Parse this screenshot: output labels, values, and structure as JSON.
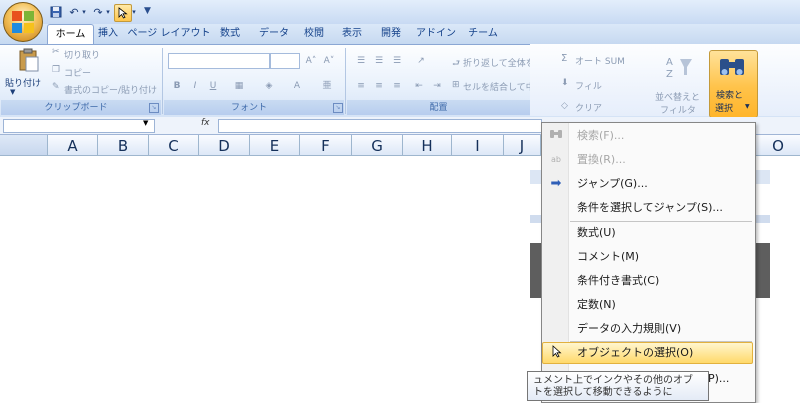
{
  "qat": {
    "customize": "▼"
  },
  "tabs": [
    {
      "label": "ホーム"
    },
    {
      "label": "挿入"
    },
    {
      "label": "ページ レイアウト"
    },
    {
      "label": "数式"
    },
    {
      "label": "データ"
    },
    {
      "label": "校閲"
    },
    {
      "label": "表示"
    },
    {
      "label": "開発"
    },
    {
      "label": "アドイン"
    },
    {
      "label": "チーム"
    }
  ],
  "clipboard": {
    "paste": "貼り付け",
    "cut": "切り取り",
    "copy": "コピー",
    "format_painter": "書式のコピー/貼り付け",
    "group": "クリップボード"
  },
  "font": {
    "group": "フォント",
    "bold": "B",
    "italic": "I",
    "underline": "U"
  },
  "alignment": {
    "wrap": "折り返して全体を",
    "merge": "セルを結合して中",
    "group": "配置"
  },
  "editing": {
    "autosum": "オート SUM",
    "fill": "フィル",
    "clear": "クリア",
    "sort_filter_1": "並べ替えと",
    "sort_filter_2": "フィルタ",
    "find_select_1": "検索と",
    "find_select_2": "選択",
    "dropdown_glyph": "▼"
  },
  "formula_bar": {
    "fx": "fx"
  },
  "columns": [
    "A",
    "B",
    "C",
    "D",
    "E",
    "F",
    "G",
    "H",
    "I",
    "J",
    "O"
  ],
  "menu": {
    "items": [
      {
        "label": "検索(F)...",
        "icon": "binoculars-icon",
        "disabled": true
      },
      {
        "label": "置換(R)...",
        "icon": "replace-icon",
        "disabled": true
      },
      {
        "label": "ジャンプ(G)...",
        "icon": "arrow-right-icon"
      },
      {
        "label": "条件を選択してジャンプ(S)..."
      },
      {
        "label": "数式(U)"
      },
      {
        "label": "コメント(M)"
      },
      {
        "label": "条件付き書式(C)"
      },
      {
        "label": "定数(N)"
      },
      {
        "label": "データの入力規則(V)"
      },
      {
        "label": "オブジェクトの選択(O)",
        "icon": "pointer-icon",
        "hover": true
      },
      {
        "label": "P)..."
      }
    ]
  },
  "tooltip": {
    "line1": "ュメント上でインクやその他のオブ",
    "line2": "トを選択して移動できるように"
  },
  "colors": {
    "accent": "#15428b",
    "hover": "#ffd96b"
  }
}
